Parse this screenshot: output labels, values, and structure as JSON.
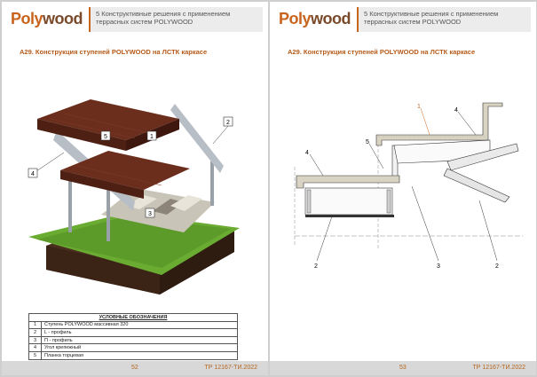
{
  "left": {
    "logo": "Polywood",
    "header": "5 Конструктивные решения с применением террасных систем POLYWOOD",
    "section_title": "А29. Конструкция ступеней POLYWOOD на ЛСТК каркасе",
    "callouts": [
      "5",
      "1",
      "2",
      "4",
      "3"
    ],
    "legend_title": "УСЛОВНЫЕ ОБОЗНАЧЕНИЯ",
    "legend": [
      {
        "n": "1",
        "text": "Ступень POLYWOOD массивная 320"
      },
      {
        "n": "2",
        "text": "L - профиль"
      },
      {
        "n": "3",
        "text": "П - профиль"
      },
      {
        "n": "4",
        "text": "Угол крепежный"
      },
      {
        "n": "5",
        "text": "Планка торцевая"
      }
    ],
    "page_number": "52",
    "doc_code": "ТР 12167-ТИ.2022"
  },
  "right": {
    "logo": "Polywood",
    "header": "5 Конструктивные решения с применением террасных систем POLYWOOD",
    "section_title": "А29. Конструкция ступеней POLYWOOD на ЛСТК каркасе",
    "labels": {
      "l1": "1",
      "l4a": "4",
      "l5": "5",
      "l4b": "4",
      "l2a": "2",
      "l3": "3",
      "l2b": "2"
    },
    "page_number": "53",
    "doc_code": "ТР 12167-ТИ.2022"
  },
  "colors": {
    "brand": "#c8641e",
    "wood": "#6b2e1d",
    "grass": "#5c9a2a"
  }
}
